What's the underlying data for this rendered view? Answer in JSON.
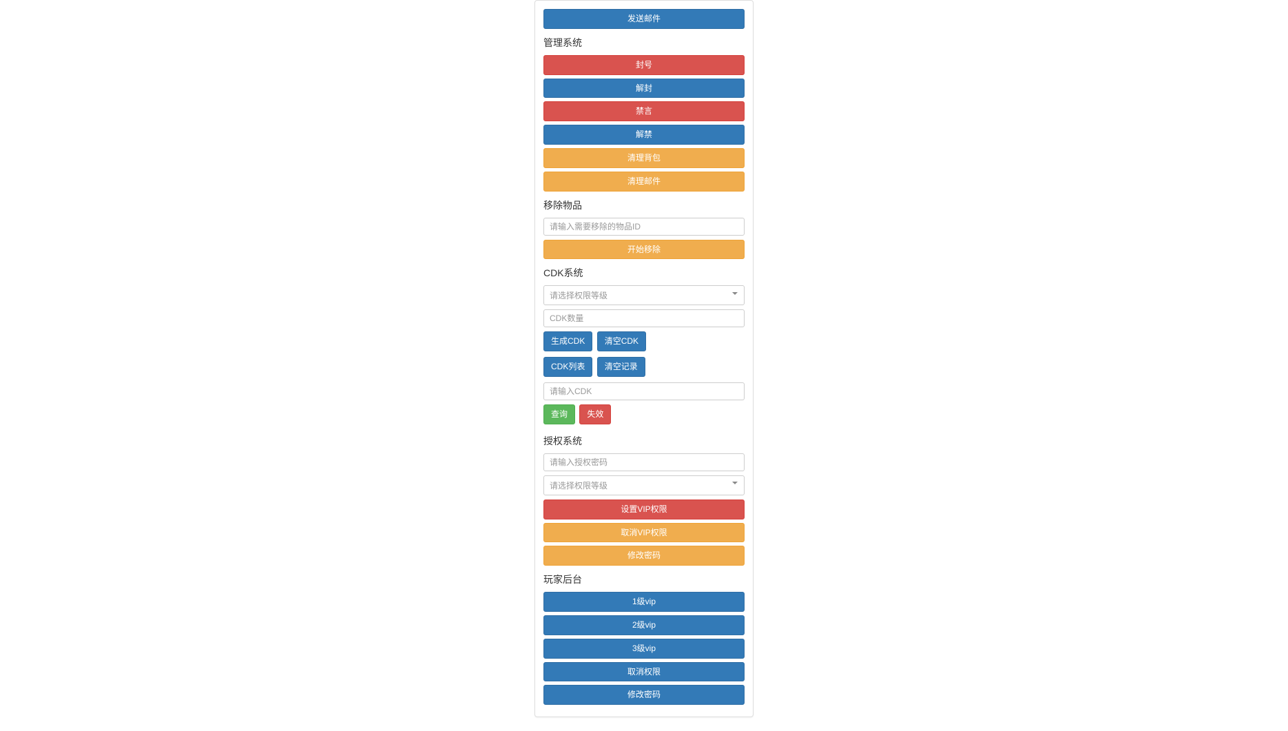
{
  "top": {
    "send_mail": "发送邮件"
  },
  "admin": {
    "title": "管理系统",
    "ban": "封号",
    "unban": "解封",
    "mute": "禁言",
    "unmute": "解禁",
    "clear_bag": "清理背包",
    "clear_mail": "清理邮件"
  },
  "remove": {
    "title": "移除物品",
    "placeholder": "请输入需要移除的物品ID",
    "start": "开始移除"
  },
  "cdk": {
    "title": "CDK系统",
    "select_placeholder": "请选择权限等级",
    "amount_placeholder": "CDK数量",
    "generate": "生成CDK",
    "clear_cdk": "清空CDK",
    "list": "CDK列表",
    "clear_log": "清空记录",
    "input_placeholder": "请输入CDK",
    "query": "查询",
    "invalidate": "失效"
  },
  "auth": {
    "title": "授权系统",
    "pwd_placeholder": "请输入授权密码",
    "select_placeholder": "请选择权限等级",
    "set_vip": "设置VIP权限",
    "cancel_vip": "取消VIP权限",
    "change_pwd": "修改密码"
  },
  "player": {
    "title": "玩家后台",
    "vip1": "1级vip",
    "vip2": "2级vip",
    "vip3": "3级vip",
    "cancel_perm": "取消权限",
    "change_pwd": "修改密码"
  }
}
